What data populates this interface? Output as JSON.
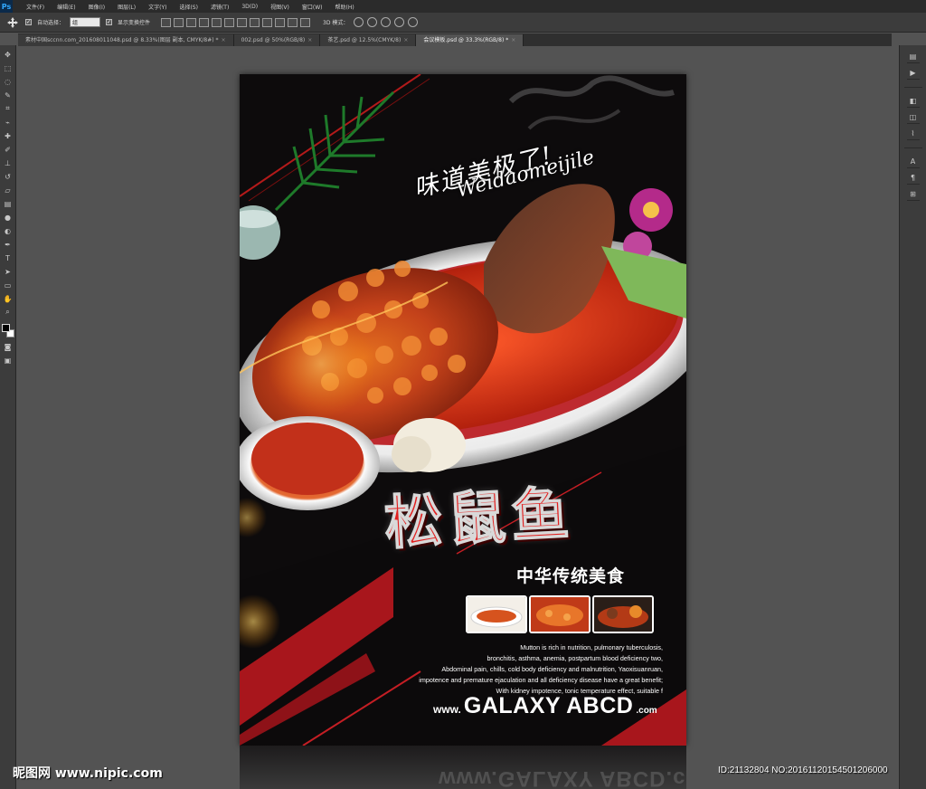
{
  "app": {
    "logo": "Ps",
    "menu": [
      "文件(F)",
      "编辑(E)",
      "图像(I)",
      "图层(L)",
      "文字(Y)",
      "选择(S)",
      "滤镜(T)",
      "3D(D)",
      "视图(V)",
      "窗口(W)",
      "帮助(H)"
    ]
  },
  "options": {
    "auto_select_label": "自动选择：",
    "auto_select_value": "组",
    "show_transform_label": "显示变换控件",
    "mode_label": "3D 模式："
  },
  "tabs": [
    {
      "label": "素材中国sccnn.com_20160801104​8.psd @ 8.33%(图层 副本, CMYK/8#) *"
    },
    {
      "label": "002.psd @ 50%(RGB/8)"
    },
    {
      "label": "茶艺.psd @ 12.5%(CMYK/8)"
    },
    {
      "label": "会议模板.psd @ 33.3%(RGB/8) *"
    }
  ],
  "active_tab": 3,
  "poster": {
    "slogan_cn": "味道美极了!",
    "slogan_en": "Weidaomeijile",
    "title_cn": "松鼠鱼",
    "subtitle_cn": "中华传统美食",
    "description": [
      "Mutton is rich in nutrition, pulmonary tuberculosis,",
      "bronchitis, asthma, anemia, postpartum blood deficiency two,",
      "Abdominal pain, chills, cold body deficiency and malnutrition, Yaoxisuanruan,",
      "impotence and premature ejaculation and all deficiency disease have a great benefit;",
      "With kidney impotence, tonic temperature effect, suitable f"
    ],
    "brand_www": "www.",
    "brand_main": "GALAXY ABCD",
    "brand_com": ".com",
    "reflection_text": "www.GALAXY ABCD.com"
  },
  "watermark": {
    "left": "昵图网 www.nipic.com",
    "right": "ID:21132804 NO:20161120154501206000"
  },
  "colors": {
    "accent_red": "#e21f1f",
    "stripe_red": "#a8161c",
    "canvas_bg": "#535353"
  }
}
